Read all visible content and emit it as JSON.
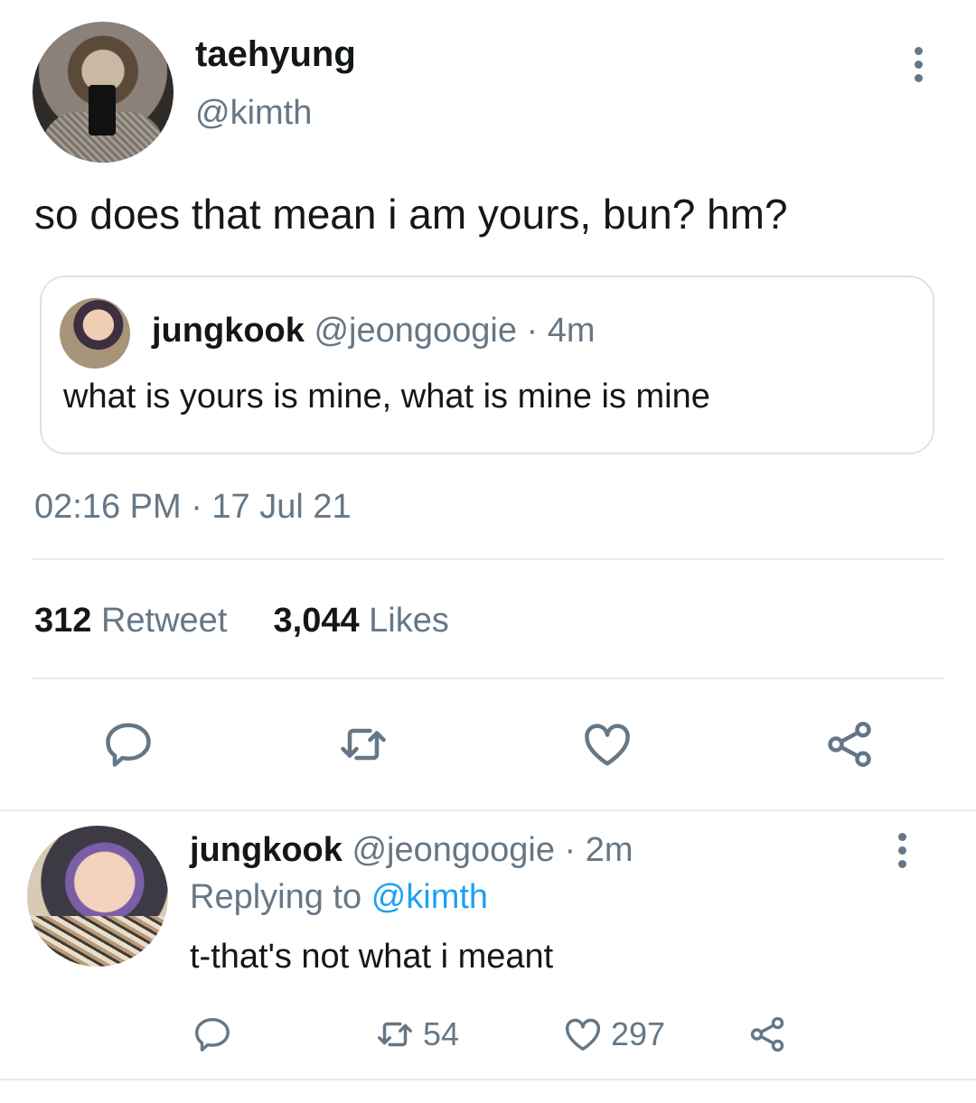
{
  "main_tweet": {
    "author": {
      "display_name": "taehyung",
      "handle": "@kimth"
    },
    "text": "so does that mean i am yours, bun? hm?",
    "quote": {
      "display_name": "jungkook",
      "handle_time": "@jeongoogie · 4m",
      "text": "what is yours is mine, what is mine is mine"
    },
    "timestamp": "02:16 PM · 17 Jul 21",
    "stats": {
      "retweets_count": "312",
      "retweets_label": "Retweet",
      "likes_count": "3,044",
      "likes_label": "Likes"
    },
    "icons": {
      "reply": "reply-icon",
      "retweet": "retweet-icon",
      "like": "heart-icon",
      "share": "share-icon",
      "more": "more-vertical-icon"
    }
  },
  "reply_tweet": {
    "display_name": "jungkook",
    "handle_time": "@jeongoogie · 2m",
    "replying_prefix": "Replying to",
    "replying_mention": "@kimth",
    "text": "t-that's not what i meant",
    "retweet_count": "54",
    "like_count": "297"
  },
  "colors": {
    "text_primary": "#14171a",
    "text_secondary": "#657786",
    "link": "#1da1f2",
    "divider": "#e6ecf0"
  }
}
